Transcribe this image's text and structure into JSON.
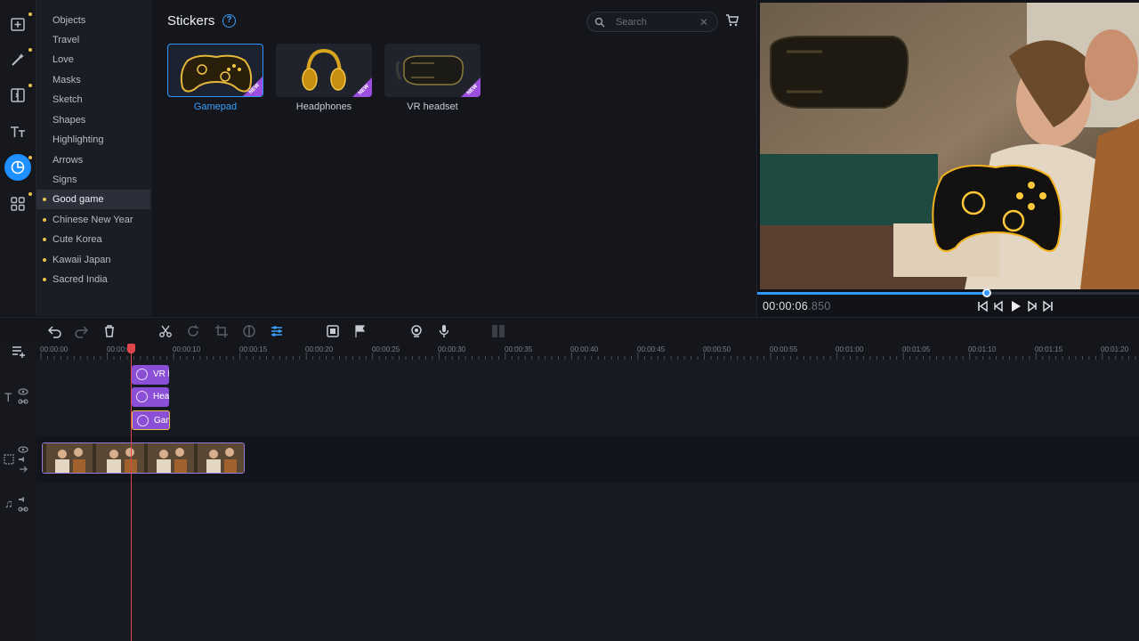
{
  "rail": {
    "items": [
      {
        "name": "import-icon",
        "active": false,
        "dot": true
      },
      {
        "name": "magic-wand-icon",
        "active": false,
        "dot": true
      },
      {
        "name": "transitions-icon",
        "active": false,
        "dot": true
      },
      {
        "name": "titles-icon",
        "active": false,
        "dot": false
      },
      {
        "name": "stickers-icon",
        "active": true,
        "dot": true
      },
      {
        "name": "more-tools-icon",
        "active": false,
        "dot": true
      }
    ]
  },
  "categories": {
    "items": [
      {
        "label": "Objects",
        "bullet": false
      },
      {
        "label": "Travel",
        "bullet": false
      },
      {
        "label": "Love",
        "bullet": false
      },
      {
        "label": "Masks",
        "bullet": false
      },
      {
        "label": "Sketch",
        "bullet": false
      },
      {
        "label": "Shapes",
        "bullet": false
      },
      {
        "label": "Highlighting",
        "bullet": false
      },
      {
        "label": "Arrows",
        "bullet": false
      },
      {
        "label": "Signs",
        "bullet": false
      },
      {
        "label": "Good game",
        "bullet": true,
        "selected": true
      },
      {
        "label": "Chinese New Year",
        "bullet": true
      },
      {
        "label": "Cute Korea",
        "bullet": true
      },
      {
        "label": "Kawaii Japan",
        "bullet": true
      },
      {
        "label": "Sacred India",
        "bullet": true
      }
    ]
  },
  "panel": {
    "title": "Stickers",
    "help": "?",
    "search_placeholder": "Search",
    "search_clear": "✕"
  },
  "stickers": [
    {
      "label": "Gamepad",
      "badge": "NEW",
      "selected": true
    },
    {
      "label": "Headphones",
      "badge": "NEW",
      "selected": false
    },
    {
      "label": "VR headset",
      "badge": "NEW",
      "selected": false
    }
  ],
  "preview": {
    "timecode_main": "00:00:06",
    "timecode_ms": ".850",
    "progress": 0.6
  },
  "ruler": {
    "labels": [
      "00:00:00",
      "00:00:05",
      "00:00:10",
      "00:00:15",
      "00:00:20",
      "00:00:25",
      "00:00:30",
      "00:00:35",
      "00:00:40",
      "00:00:45",
      "00:00:50",
      "00:00:55",
      "00:01:00",
      "00:01:05",
      "00:01:10",
      "00:01:15",
      "00:01:20"
    ]
  },
  "timeline": {
    "clips": [
      {
        "label": "VR h",
        "selected": false
      },
      {
        "label": "Hea",
        "selected": false
      },
      {
        "label": "Gan",
        "selected": true
      }
    ]
  },
  "colors": {
    "accent": "#1e90ff",
    "sticker_clip": "#8a4fd6",
    "playhead": "#e0464b",
    "new_badge": "#9b4fe0",
    "highlight_dot": "#e8c14a"
  }
}
